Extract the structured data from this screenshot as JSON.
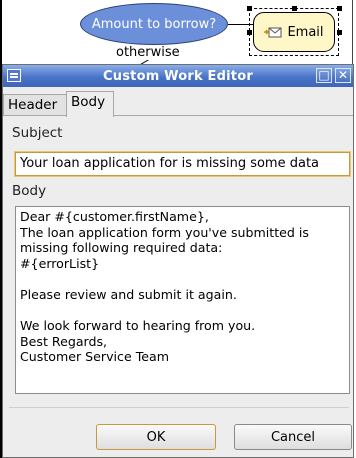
{
  "canvas": {
    "decision_node_label": "Amount to borrow?",
    "otherwise_label": "otherwise",
    "email_node_label": "Email"
  },
  "dialog": {
    "title": "Custom Work Editor",
    "window_buttons": {
      "maximize": "□",
      "close": "✕"
    },
    "tabs": [
      {
        "label": "Header",
        "active": false
      },
      {
        "label": "Body",
        "active": true
      }
    ],
    "subject_label": "Subject",
    "subject_value": "Your loan application for is missing some data",
    "body_label": "Body",
    "body_value": "Dear #{customer.firstName},\nThe loan application form you've submitted is missing following required data:\n#{errorList}\n\nPlease review and submit it again.\n\nWe look forward to hearing from you.\nBest Regards,\nCustomer Service Team",
    "ok_label": "OK",
    "cancel_label": "Cancel"
  },
  "colors": {
    "titlebar": "#4a74c8",
    "decision_node": "#6b8fd8",
    "email_node": "#fff7c8",
    "focus_border": "#c49a3b"
  }
}
